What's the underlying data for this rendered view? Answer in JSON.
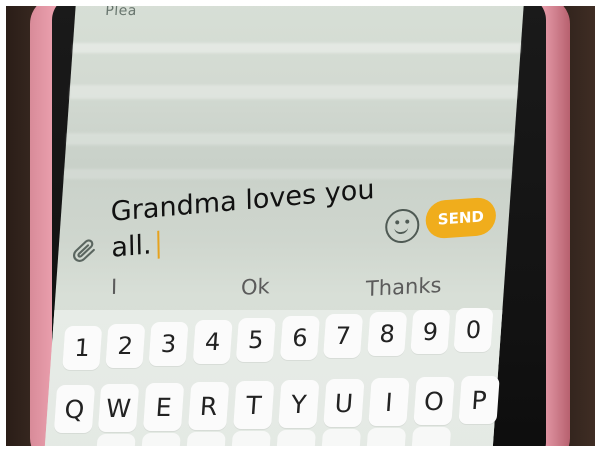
{
  "screen": {
    "partial_text": "Plea"
  },
  "compose": {
    "message_line_1": "Grandma loves you",
    "message_line_2": "all.",
    "send_label": "SEND"
  },
  "suggestions": [
    "I",
    "Ok",
    "Thanks"
  ],
  "keyboard": {
    "numbers": [
      "1",
      "2",
      "3",
      "4",
      "5",
      "6",
      "7",
      "8",
      "9",
      "0"
    ],
    "letters": [
      "Q",
      "W",
      "E",
      "R",
      "T",
      "Y",
      "U",
      "I",
      "O",
      "P"
    ]
  },
  "icons": {
    "attach": "paperclip-icon",
    "emoji": "smiley-face-icon"
  },
  "colors": {
    "send_accent": "#f0ad1c",
    "case_pink": "#d88b99",
    "screen_bg": "#d5dbd3"
  }
}
